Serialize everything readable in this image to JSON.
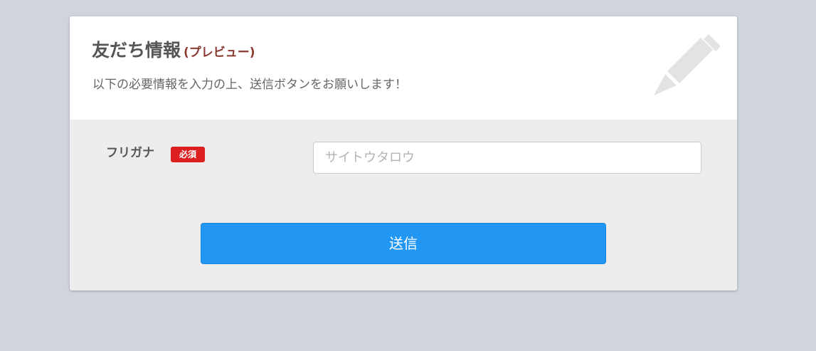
{
  "header": {
    "title": "友だち情報",
    "preview_tag": "(プレビュー)",
    "description": "以下の必要情報を入力の上、送信ボタンをお願いします！",
    "icon": "pencil-icon"
  },
  "form": {
    "fields": [
      {
        "label": "フリガナ",
        "required_badge": "必須",
        "value": "",
        "placeholder": "サイトウタロウ"
      }
    ],
    "submit_label": "送信"
  },
  "colors": {
    "background": "#d0d4dc",
    "card_body": "#ededed",
    "preview_tag": "#8b3a32",
    "required_badge": "#dc2020",
    "submit_button": "#2196f3"
  }
}
